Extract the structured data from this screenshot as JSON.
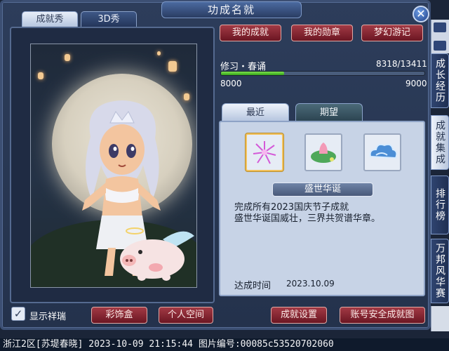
{
  "window": {
    "title": "功成名就",
    "close_label": "✕"
  },
  "left_tabs": [
    {
      "label": "成就秀",
      "active": true
    },
    {
      "label": "3D秀",
      "active": false
    }
  ],
  "top_buttons": [
    "我的成就",
    "我的勋章",
    "梦幻游记"
  ],
  "progress": {
    "name": "修习・春诵",
    "current": "8318/13411",
    "min_label": "8000",
    "max_label": "9000",
    "fill_fraction": 0.31
  },
  "detail_tabs": [
    {
      "label": "最近",
      "active": true
    },
    {
      "label": "期望",
      "active": false
    }
  ],
  "achievement": {
    "slots": [
      {
        "icon": "fireworks-icon",
        "selected": true
      },
      {
        "icon": "lotus-leaf-icon",
        "selected": false
      },
      {
        "icon": "auspicious-cloud-icon",
        "selected": false
      }
    ],
    "title": "盛世华诞",
    "description_line1": "完成所有2023国庆节子成就",
    "description_line2": "盛世华诞国威壮，三界共贺谱华章。",
    "time_label": "达成时间",
    "time_value": "2023.10.09"
  },
  "bottom": {
    "checkbox_label": "显示祥瑞",
    "checkbox_checked": true,
    "buttons": [
      "彩饰盒",
      "个人空间",
      "成就设置",
      "账号安全成就图"
    ]
  },
  "side_tabs": [
    {
      "label": "成长经历",
      "active": false
    },
    {
      "label": "成就集成",
      "active": true
    },
    {
      "label": "排行榜",
      "active": false
    },
    {
      "label": "万邦风华赛",
      "active": false
    }
  ],
  "status_bar": "浙江2区[苏堤春晓] 2023-10-09 21:15:44 图片编号:00085c53520702060",
  "colors": {
    "accent_red": "#8a2430",
    "progress_green": "#4cc027",
    "panel_blue": "#24324c",
    "detail_bg": "#c7d3e6"
  }
}
